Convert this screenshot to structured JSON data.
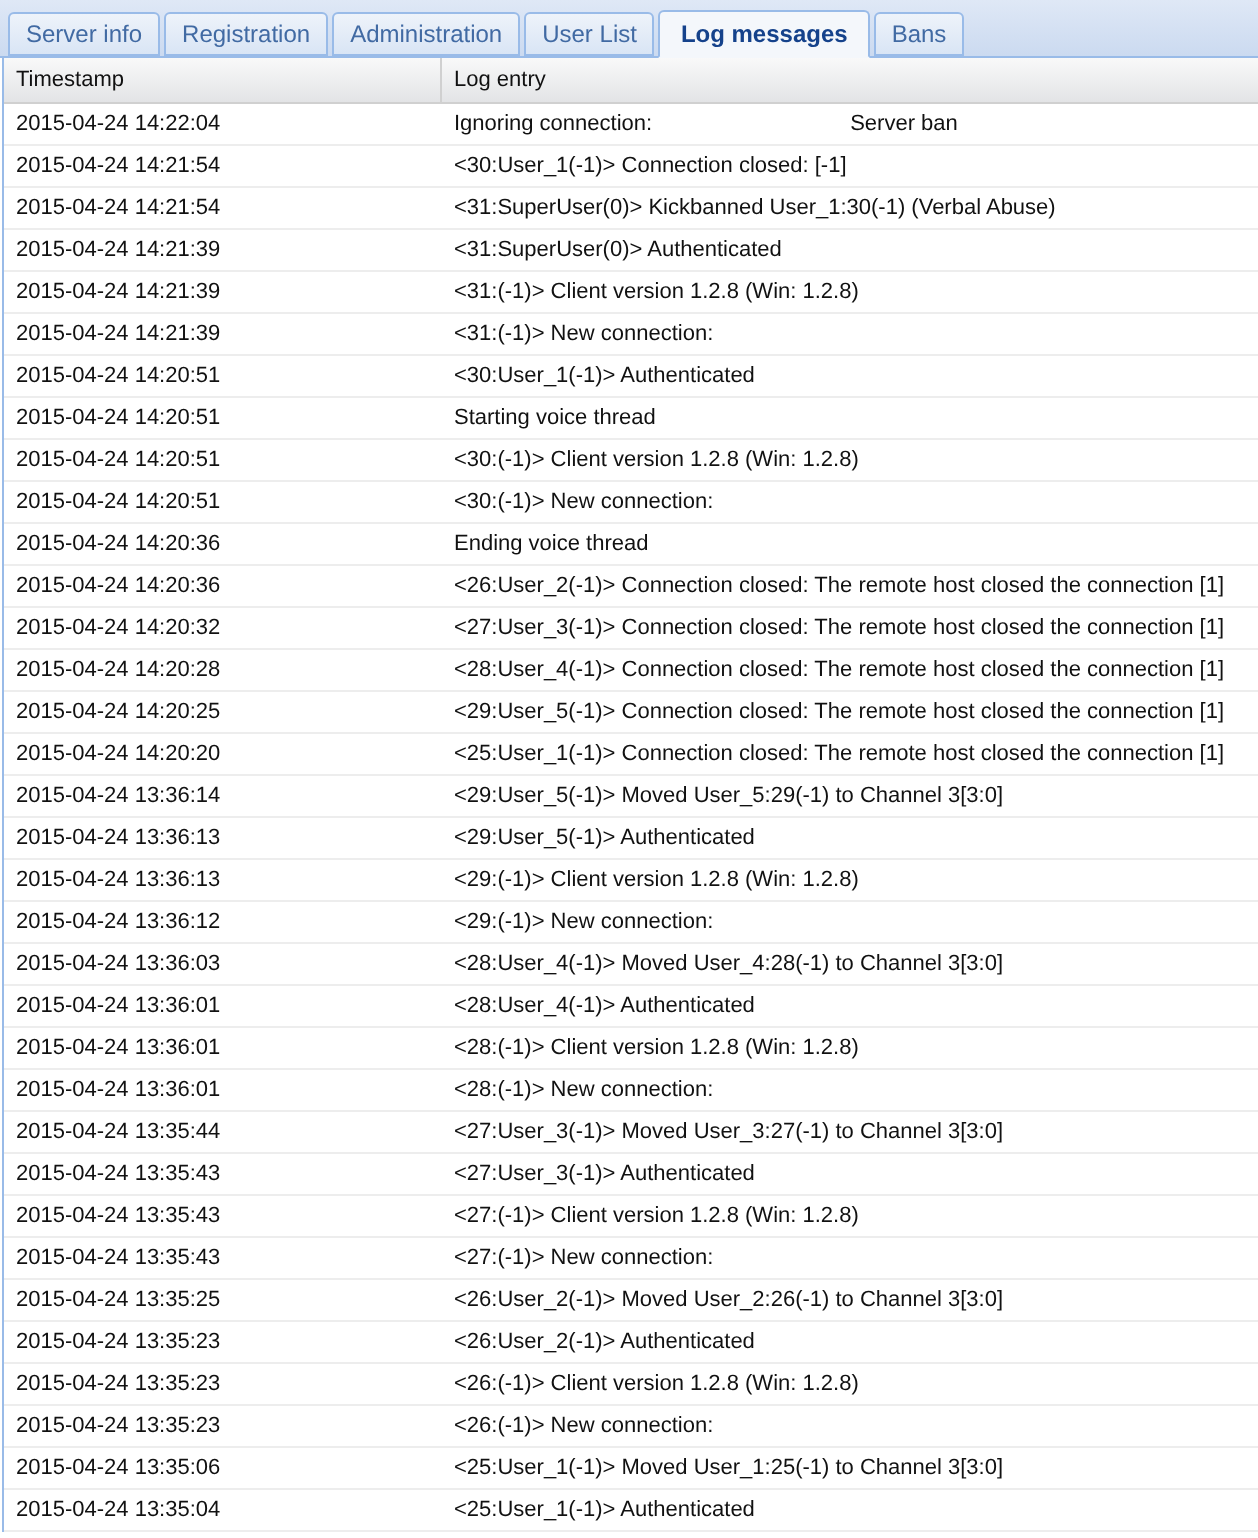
{
  "tabs": [
    {
      "label": "Server info",
      "selected": false
    },
    {
      "label": "Registration",
      "selected": false
    },
    {
      "label": "Administration",
      "selected": false
    },
    {
      "label": "User List",
      "selected": false
    },
    {
      "label": "Log messages",
      "selected": true
    },
    {
      "label": "Bans",
      "selected": false
    }
  ],
  "table": {
    "columns": [
      "Timestamp",
      "Log entry"
    ],
    "rows": [
      {
        "timestamp": "2015-04-24 14:22:04",
        "entry": "Ignoring connection:",
        "detail": "Server ban"
      },
      {
        "timestamp": "2015-04-24 14:21:54",
        "entry": "<30:User_1(-1)> Connection closed: [-1]"
      },
      {
        "timestamp": "2015-04-24 14:21:54",
        "entry": "<31:SuperUser(0)> Kickbanned User_1:30(-1) (Verbal Abuse)"
      },
      {
        "timestamp": "2015-04-24 14:21:39",
        "entry": "<31:SuperUser(0)> Authenticated"
      },
      {
        "timestamp": "2015-04-24 14:21:39",
        "entry": "<31:(-1)> Client version 1.2.8 (Win: 1.2.8)"
      },
      {
        "timestamp": "2015-04-24 14:21:39",
        "entry": "<31:(-1)> New connection:"
      },
      {
        "timestamp": "2015-04-24 14:20:51",
        "entry": "<30:User_1(-1)> Authenticated"
      },
      {
        "timestamp": "2015-04-24 14:20:51",
        "entry": "Starting voice thread"
      },
      {
        "timestamp": "2015-04-24 14:20:51",
        "entry": "<30:(-1)> Client version 1.2.8 (Win: 1.2.8)"
      },
      {
        "timestamp": "2015-04-24 14:20:51",
        "entry": "<30:(-1)> New connection:"
      },
      {
        "timestamp": "2015-04-24 14:20:36",
        "entry": "Ending voice thread"
      },
      {
        "timestamp": "2015-04-24 14:20:36",
        "entry": "<26:User_2(-1)> Connection closed: The remote host closed the connection [1]"
      },
      {
        "timestamp": "2015-04-24 14:20:32",
        "entry": "<27:User_3(-1)> Connection closed: The remote host closed the connection [1]"
      },
      {
        "timestamp": "2015-04-24 14:20:28",
        "entry": "<28:User_4(-1)> Connection closed: The remote host closed the connection [1]"
      },
      {
        "timestamp": "2015-04-24 14:20:25",
        "entry": "<29:User_5(-1)> Connection closed: The remote host closed the connection [1]"
      },
      {
        "timestamp": "2015-04-24 14:20:20",
        "entry": "<25:User_1(-1)> Connection closed: The remote host closed the connection [1]"
      },
      {
        "timestamp": "2015-04-24 13:36:14",
        "entry": "<29:User_5(-1)> Moved User_5:29(-1) to Channel 3[3:0]"
      },
      {
        "timestamp": "2015-04-24 13:36:13",
        "entry": "<29:User_5(-1)> Authenticated"
      },
      {
        "timestamp": "2015-04-24 13:36:13",
        "entry": "<29:(-1)> Client version 1.2.8 (Win: 1.2.8)"
      },
      {
        "timestamp": "2015-04-24 13:36:12",
        "entry": "<29:(-1)> New connection:"
      },
      {
        "timestamp": "2015-04-24 13:36:03",
        "entry": "<28:User_4(-1)> Moved User_4:28(-1) to Channel 3[3:0]"
      },
      {
        "timestamp": "2015-04-24 13:36:01",
        "entry": "<28:User_4(-1)> Authenticated"
      },
      {
        "timestamp": "2015-04-24 13:36:01",
        "entry": "<28:(-1)> Client version 1.2.8 (Win: 1.2.8)"
      },
      {
        "timestamp": "2015-04-24 13:36:01",
        "entry": "<28:(-1)> New connection:"
      },
      {
        "timestamp": "2015-04-24 13:35:44",
        "entry": "<27:User_3(-1)> Moved User_3:27(-1) to Channel 3[3:0]"
      },
      {
        "timestamp": "2015-04-24 13:35:43",
        "entry": "<27:User_3(-1)> Authenticated"
      },
      {
        "timestamp": "2015-04-24 13:35:43",
        "entry": "<27:(-1)> Client version 1.2.8 (Win: 1.2.8)"
      },
      {
        "timestamp": "2015-04-24 13:35:43",
        "entry": "<27:(-1)> New connection:"
      },
      {
        "timestamp": "2015-04-24 13:35:25",
        "entry": "<26:User_2(-1)> Moved User_2:26(-1) to Channel 3[3:0]"
      },
      {
        "timestamp": "2015-04-24 13:35:23",
        "entry": "<26:User_2(-1)> Authenticated"
      },
      {
        "timestamp": "2015-04-24 13:35:23",
        "entry": "<26:(-1)> Client version 1.2.8 (Win: 1.2.8)"
      },
      {
        "timestamp": "2015-04-24 13:35:23",
        "entry": "<26:(-1)> New connection:"
      },
      {
        "timestamp": "2015-04-24 13:35:06",
        "entry": "<25:User_1(-1)> Moved User_1:25(-1) to Channel 3[3:0]"
      },
      {
        "timestamp": "2015-04-24 13:35:04",
        "entry": "<25:User_1(-1)> Authenticated"
      }
    ]
  }
}
